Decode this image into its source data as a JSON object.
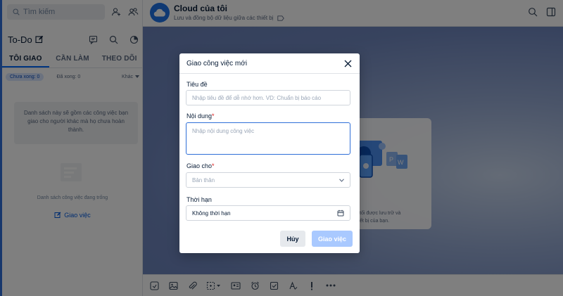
{
  "sidebar": {
    "search_placeholder": "Tìm kiếm",
    "todo_title": "To-Do",
    "tabs": [
      {
        "label": "TÔI GIAO",
        "active": true
      },
      {
        "label": "CẦN LÀM",
        "active": false
      },
      {
        "label": "THEO DÕI",
        "active": false
      }
    ],
    "filter_pending": "Chưa xong: 0",
    "filter_done": "Đã xong: 0",
    "filter_more": "Khác",
    "empty_message": "Danh sách này sẽ gồm các công việc bạn giao cho người khác mà họ chưa hoàn thành.",
    "empty_caption": "Danh sách công việc đang trống",
    "assign_link": "Giao việc"
  },
  "header": {
    "title": "Cloud của tôi",
    "subtitle": "Lưu và đồng bộ dữ liệu giữa các thiết bị"
  },
  "background_card": {
    "text_line1": "tối được lưu trữ và",
    "text_line2": "ết bị của bạn."
  },
  "modal": {
    "title": "Giao công việc mới",
    "fields": {
      "title_label": "Tiêu đề",
      "title_placeholder": "Nhập tiêu đề để dễ nhớ hơn. VD: Chuẩn bị báo cáo",
      "content_label": "Nội dung",
      "content_placeholder": "Nhập nội dung công việc",
      "assignee_label": "Giao cho",
      "assignee_value": "Bản thân",
      "deadline_label": "Thời hạn",
      "deadline_value": "Không thời hạn"
    },
    "cancel_label": "Hủy",
    "submit_label": "Giao việc",
    "required_mark": "*"
  },
  "colors": {
    "accent": "#0068ff",
    "required": "#d91b1b",
    "submit_disabled": "#a9c9ff"
  }
}
